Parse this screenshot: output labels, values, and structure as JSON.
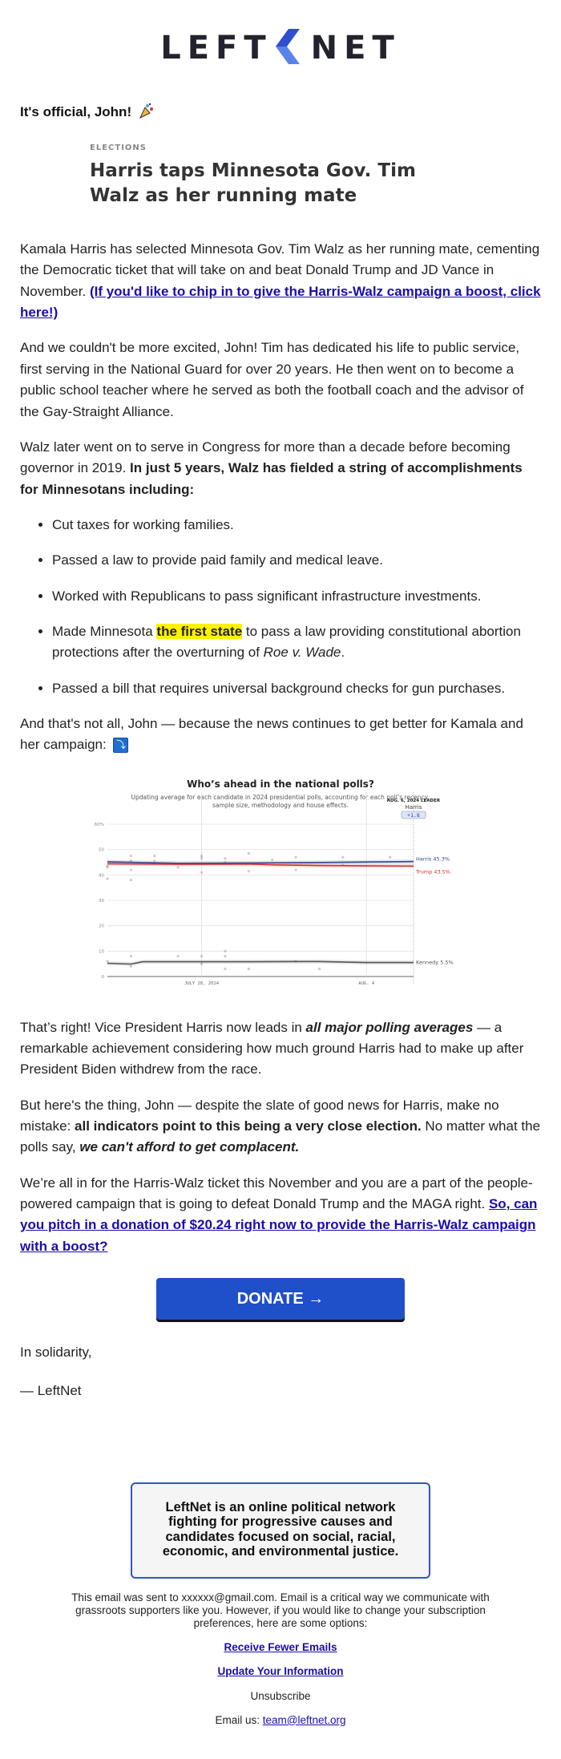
{
  "brand": {
    "logo_left": "LEFT",
    "logo_right": "NET",
    "logo_icon": "chevron-left-mark",
    "accent_color": "#2f55c8"
  },
  "greeting": {
    "text": "It's official, John!",
    "emoji": "party-popper-icon"
  },
  "article": {
    "kicker": "ELECTIONS",
    "headline": "Harris taps Minnesota Gov. Tim Walz as her running mate"
  },
  "body": {
    "p1_text": "Kamala Harris has selected Minnesota Gov. Tim Walz as her running mate, cementing the Democratic ticket that will take on and beat Donald Trump and JD Vance in November. ",
    "p1_link": "(If you'd like to chip in to give the Harris-Walz campaign a boost, click here!)",
    "p2": "And we couldn't be more excited, John! Tim has dedicated his life to public service, first serving in the National Guard for over 20 years. He then went on to become a public school teacher where he served as both the football coach and the advisor of the Gay-Straight Alliance.",
    "p3_text": "Walz later went on to serve in Congress for more than a decade before becoming governor in 2019. ",
    "p3_bold": "In just 5 years, Walz has fielded a string of accomplishments for Minnesotans including:",
    "accomplishments": [
      "Cut taxes for working families.",
      "Passed a law to provide paid family and medical leave.",
      "Worked with Republicans to pass significant infrastructure investments."
    ],
    "acc4_pre": "Made Minnesota ",
    "acc4_highlight": "the first state",
    "acc4_mid": " to pass a law providing constitutional abortion protections after the overturning of ",
    "acc4_italic": "Roe v. Wade",
    "acc4_end": ".",
    "acc5": "Passed a bill that requires universal background checks for gun purchases.",
    "p4_text": "And that's not all, John — because the news continues to get better for Kamala and her campaign:",
    "p4_emoji": "⤵",
    "p5_pre": "That’s right! Vice President Harris now leads in ",
    "p5_bolditalic": "all major polling averages",
    "p5_post": " — a remarkable achievement considering how much ground Harris had to make up after President Biden withdrew from the race.",
    "p6_pre": "But here's the thing, John — despite the slate of good news for Harris, make no mistake: ",
    "p6_bold": "all indicators point to this being a very close election.",
    "p6_mid": " No matter what the polls say, ",
    "p6_bolditalic": "we can't afford to get complacent.",
    "p7_text": "We’re all in for the Harris-Walz ticket this November and you are a part of the people-powered campaign that is going to defeat Donald Trump and the MAGA right. ",
    "p7_link": "So, can you pitch in a donation of $20.24 right now to provide the Harris-Walz campaign with a boost?",
    "donate_label": "DONATE →",
    "signoff_1": "In solidarity,",
    "signoff_2": "— LeftNet"
  },
  "chart_data": {
    "type": "line",
    "title": "Who’s ahead in the national polls?",
    "subtitle": "Updating average for each candidate in 2024 presidential polls, accounting for each poll’s recency, sample size, methodology and house effects.",
    "leader_label": "AUG. 6, 2024 LEADER",
    "leader_name": "Harris",
    "leader_margin": "+1.8",
    "ylim": [
      0,
      60
    ],
    "yticks": [
      "0",
      "10",
      "20",
      "30",
      "40",
      "50",
      "60%"
    ],
    "x_tick_labels": [
      {
        "label": "JULY 28, 2024",
        "day": 4
      },
      {
        "label": "AUG. 4",
        "day": 11
      }
    ],
    "x_range_days": [
      0,
      13
    ],
    "grid": true,
    "series": [
      {
        "name": "Harris",
        "end_label": "Harris 45.3%",
        "color": "#2b4a8f",
        "points": [
          [
            0,
            45.2
          ],
          [
            3,
            44.6
          ],
          [
            6,
            44.7
          ],
          [
            9,
            44.9
          ],
          [
            11,
            45.1
          ],
          [
            13,
            45.3
          ]
        ]
      },
      {
        "name": "Trump",
        "end_label": "Trump 43.5%",
        "color": "#d0312d",
        "points": [
          [
            0,
            44.4
          ],
          [
            3,
            44.2
          ],
          [
            6,
            44.3
          ],
          [
            7,
            44.0
          ],
          [
            9,
            43.7
          ],
          [
            11,
            43.6
          ],
          [
            13,
            43.5
          ]
        ]
      },
      {
        "name": "Kennedy",
        "end_label": "Kennedy 5.5%",
        "color": "#555555",
        "points": [
          [
            0,
            5.2
          ],
          [
            1,
            4.9
          ],
          [
            1.5,
            5.8
          ],
          [
            6,
            5.8
          ],
          [
            9,
            5.9
          ],
          [
            11,
            5.5
          ],
          [
            13,
            5.5
          ]
        ]
      }
    ],
    "polls": [
      {
        "series": "Harris",
        "points": [
          [
            0,
            43.5
          ],
          [
            0,
            38.5
          ],
          [
            1,
            45.5
          ],
          [
            2,
            47.5
          ],
          [
            4,
            47.5
          ],
          [
            5,
            46.5
          ],
          [
            6,
            48.5
          ],
          [
            8,
            47
          ],
          [
            10,
            47
          ],
          [
            12,
            47
          ],
          [
            1,
            38
          ]
        ]
      },
      {
        "series": "Trump",
        "points": [
          [
            0,
            43
          ],
          [
            1,
            47.5
          ],
          [
            1,
            42
          ],
          [
            2,
            45.5
          ],
          [
            3,
            43
          ],
          [
            4,
            46.5
          ],
          [
            5,
            45
          ],
          [
            6,
            41.5
          ],
          [
            7,
            46
          ],
          [
            8,
            42
          ],
          [
            10,
            44
          ],
          [
            4,
            41
          ]
        ]
      },
      {
        "series": "Kennedy",
        "points": [
          [
            0,
            6
          ],
          [
            1,
            4
          ],
          [
            1,
            8
          ],
          [
            3,
            8
          ],
          [
            4,
            8
          ],
          [
            4,
            5
          ],
          [
            5,
            10
          ],
          [
            5,
            8
          ],
          [
            5,
            3
          ],
          [
            6,
            3
          ],
          [
            8,
            6
          ],
          [
            9,
            3
          ]
        ]
      }
    ]
  },
  "about": {
    "text": "LeftNet is an online political network fighting for progressive causes and candidates focused on social, racial, economic, and environmental justice."
  },
  "footer": {
    "fine_print": "This email was sent to xxxxxx@gmail.com. Email is a critical way we communicate with grassroots supporters like you. However, if you would like to change your subscription preferences, here are some options:",
    "link_fewer": "Receive Fewer Emails",
    "link_update": "Update Your Information",
    "unsubscribe": "Unsubscribe",
    "email_label": "Email us: ",
    "email_link": "team@leftnet.org"
  }
}
